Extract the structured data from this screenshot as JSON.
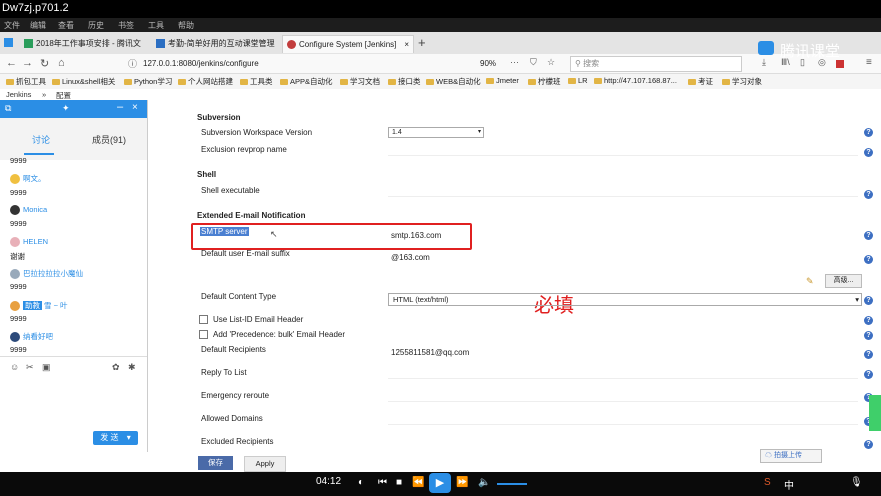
{
  "window_title": "Dw7zj.p701.2",
  "menu": [
    "文件",
    "编辑",
    "查看",
    "历史",
    "书签",
    "工具",
    "帮助"
  ],
  "tabs": [
    {
      "label": "2018年工作事项安排 - 腾讯文",
      "active": false
    },
    {
      "label": "考勤-简单好用的互动课堂管理",
      "active": false
    },
    {
      "label": "Configure System [Jenkins]",
      "active": true
    }
  ],
  "nav": {
    "url": "127.0.0.1:8080/jenkins/configure",
    "zoom": "90%",
    "search_placeholder": "搜索"
  },
  "watermark": "腾讯课堂",
  "bookmarks": [
    "抓包工具",
    "Linux&shell相关",
    "Python学习",
    "个人网站搭建",
    "工具类",
    "APP&自动化",
    "学习文档",
    "接口类",
    "WEB&自动化",
    "Jmeter",
    "柠檬班",
    "LR",
    "http://47.107.168.87...",
    "考证",
    "学习对象"
  ],
  "breadcrumb": {
    "root": "Jenkins",
    "sep": "»",
    "page": "配置"
  },
  "chat": {
    "tab_discuss": "讨论",
    "tab_members": "成员(91)",
    "messages": [
      {
        "name": "",
        "text": "9999"
      },
      {
        "name": "啊文。",
        "text": "9999"
      },
      {
        "name": "Monica",
        "text": "9999"
      },
      {
        "name": "HELEN",
        "text": "谢谢"
      },
      {
        "name": "巴拉拉拉拉小魔仙",
        "text": "9999"
      },
      {
        "name": "雪 ~ 叶",
        "badge": "助教",
        "text": "9999"
      },
      {
        "name": "纳看好吧",
        "text": "9999"
      }
    ],
    "send_label": "发 送"
  },
  "form": {
    "sec_subversion": "Subversion",
    "svn_version_label": "Subversion Workspace Version",
    "svn_version_value": "1.4",
    "exclusion_label": "Exclusion revprop name",
    "sec_shell": "Shell",
    "shell_label": "Shell executable",
    "sec_email": "Extended E-mail Notification",
    "smtp_label": "SMTP server",
    "smtp_value": "smtp.163.com",
    "suffix_label": "Default user E-mail suffix",
    "suffix_value": "@163.com",
    "advanced_label": "高级...",
    "content_type_label": "Default Content Type",
    "content_type_value": "HTML (text/html)",
    "listid_label": "Use List-ID Email Header",
    "precedence_label": "Add 'Precedence: bulk' Email Header",
    "recipients_label": "Default Recipients",
    "recipients_value": "1255811581@qq.com",
    "replyto_label": "Reply To List",
    "emergency_label": "Emergency reroute",
    "allowed_label": "Allowed Domains",
    "excluded_label": "Excluded Recipients",
    "required_note": "必填",
    "save_label": "保存",
    "apply_label": "Apply",
    "upload_label": "拍摄上传"
  },
  "player": {
    "time": "04:12"
  }
}
